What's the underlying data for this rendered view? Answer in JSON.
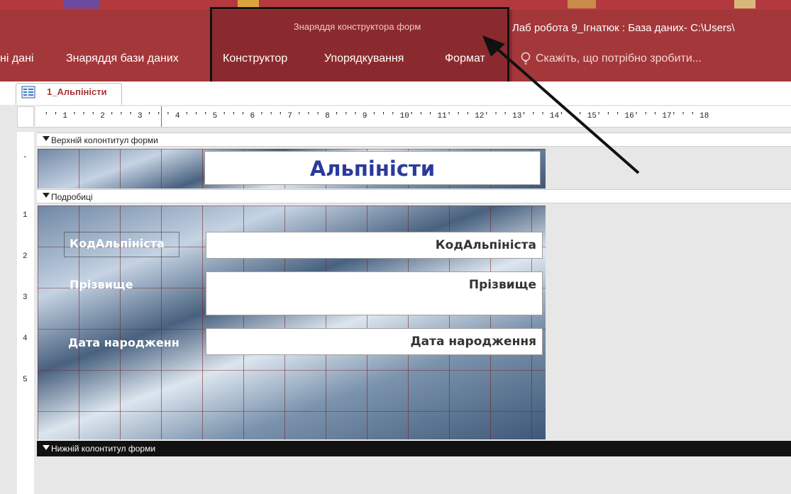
{
  "window": {
    "app_title": "Лаб робота 9_Ігнатюк : База даних- C:\\Users\\",
    "context_tab_group": "Знаряддя конструктора форм"
  },
  "ribbon": {
    "tabs": [
      {
        "label": "ні дані"
      },
      {
        "label": "Знаряддя бази даних"
      },
      {
        "label": "Конструктор"
      },
      {
        "label": "Упорядкування"
      },
      {
        "label": "Формат"
      }
    ],
    "tell_me": "Скажіть, що потрібно зробити..."
  },
  "document_tab": {
    "label": "1_Альпіністи"
  },
  "ruler": {
    "horizontal": "' ' 1 ' ' ' 2 ' ' ' 3 ' ' ' 4 ' ' ' 5 ' ' ' 6 ' ' ' 7 ' ' ' 8 ' ' ' 9 ' ' ' 10' ' ' 11' ' ' 12' ' ' 13' ' ' 14' ' ' 15' ' ' 16' ' ' 17' ' ' 18",
    "vertical_marks": [
      "1",
      "2",
      "3",
      "4",
      "5"
    ]
  },
  "sections": {
    "header": "Верхній колонтитул форми",
    "detail": "Подробиці",
    "footer": "Нижній колонтитул форми"
  },
  "form": {
    "title": "Альпіністи",
    "fields": [
      {
        "label": "КодАльпініста",
        "control": "КодАльпініста"
      },
      {
        "label": "Прізвище",
        "control": "Прізвище"
      },
      {
        "label": "Дата народженн",
        "control": "Дата народження"
      }
    ]
  },
  "colors": {
    "ribbon": "#a4373a",
    "context_band": "#8b2a2e",
    "title_text": "#2b3a9a"
  }
}
